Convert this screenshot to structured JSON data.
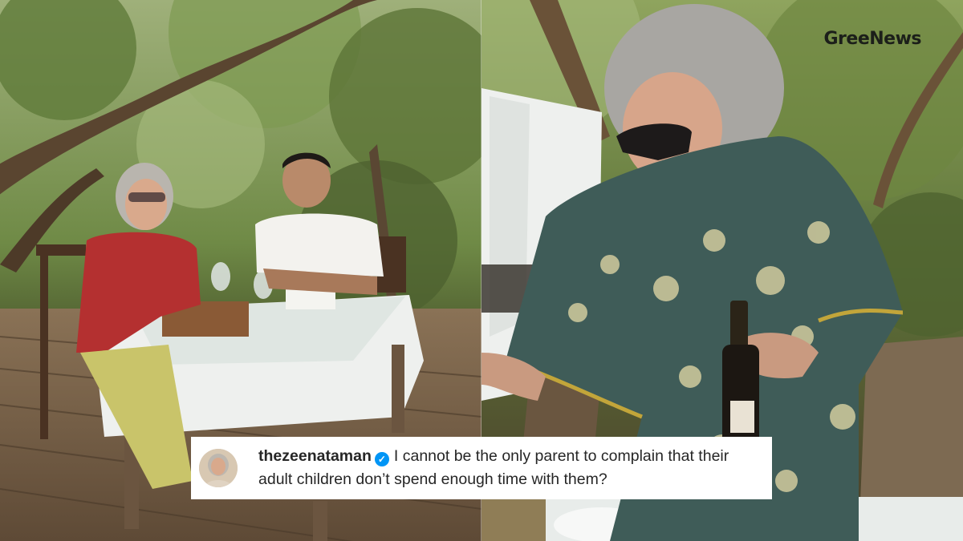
{
  "watermark": {
    "brand": "GreeNews"
  },
  "post_caption": {
    "handle": "thezeenataman",
    "text": "I cannot be the only parent to complain that their adult children don’t spend enough time with them?",
    "verified_icon": "verified-badge-icon",
    "verified_color": "#0095f6"
  },
  "photos": [
    {
      "name": "left-photo",
      "description_icon": "outdoor-dining-photo"
    },
    {
      "name": "right-photo",
      "description_icon": "woman-with-wine-bottle-photo"
    }
  ]
}
